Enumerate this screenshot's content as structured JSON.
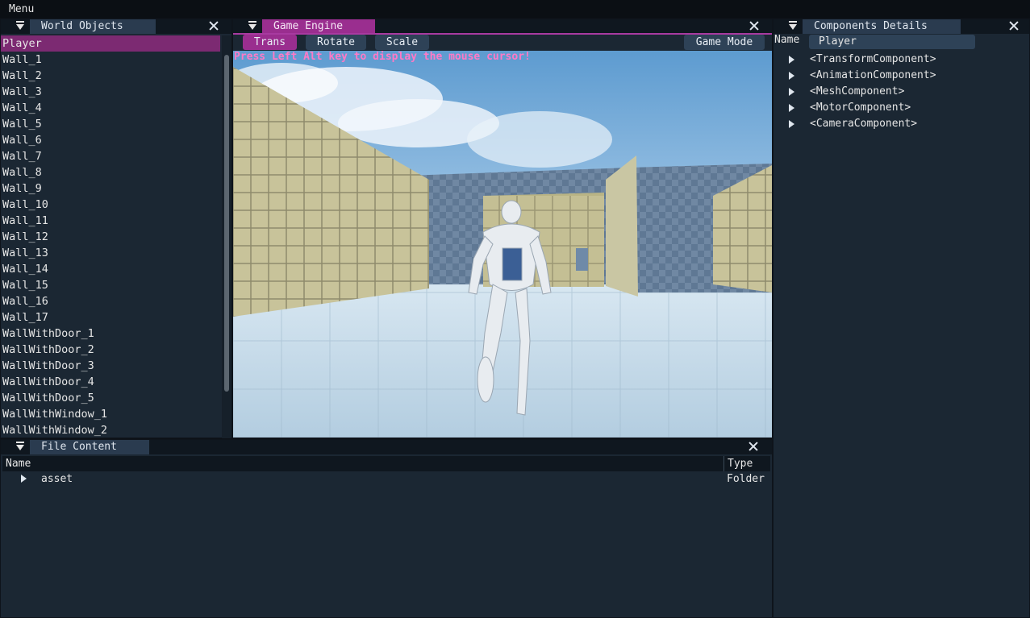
{
  "menubar": {
    "menu_label": "Menu"
  },
  "world_objects": {
    "title": "World Objects",
    "items": [
      "Player",
      "Wall_1",
      "Wall_2",
      "Wall_3",
      "Wall_4",
      "Wall_5",
      "Wall_6",
      "Wall_7",
      "Wall_8",
      "Wall_9",
      "Wall_10",
      "Wall_11",
      "Wall_12",
      "Wall_13",
      "Wall_14",
      "Wall_15",
      "Wall_16",
      "Wall_17",
      "WallWithDoor_1",
      "WallWithDoor_2",
      "WallWithDoor_3",
      "WallWithDoor_4",
      "WallWithDoor_5",
      "WallWithWindow_1",
      "WallWithWindow_2"
    ],
    "selected": "Player"
  },
  "game_engine": {
    "title": "Game Engine",
    "buttons": {
      "trans": "Trans",
      "rotate": "Rotate",
      "scale": "Scale",
      "game_mode": "Game Mode"
    },
    "hint": "Press Left Alt key to display the mouse cursor!"
  },
  "components": {
    "title": "Components Details",
    "name_label": "Name",
    "name_value": "Player",
    "items": [
      "<TransformComponent>",
      "<AnimationComponent>",
      "<MeshComponent>",
      "<MotorComponent>",
      "<CameraComponent>"
    ]
  },
  "file_content": {
    "title": "File Content",
    "col_name": "Name",
    "col_type": "Type",
    "rows": [
      {
        "name": "asset",
        "type": "Folder"
      }
    ]
  },
  "colors": {
    "accent": "#9a2e8f",
    "panel_bg": "#1b2733",
    "hint": "#ff79c6"
  }
}
